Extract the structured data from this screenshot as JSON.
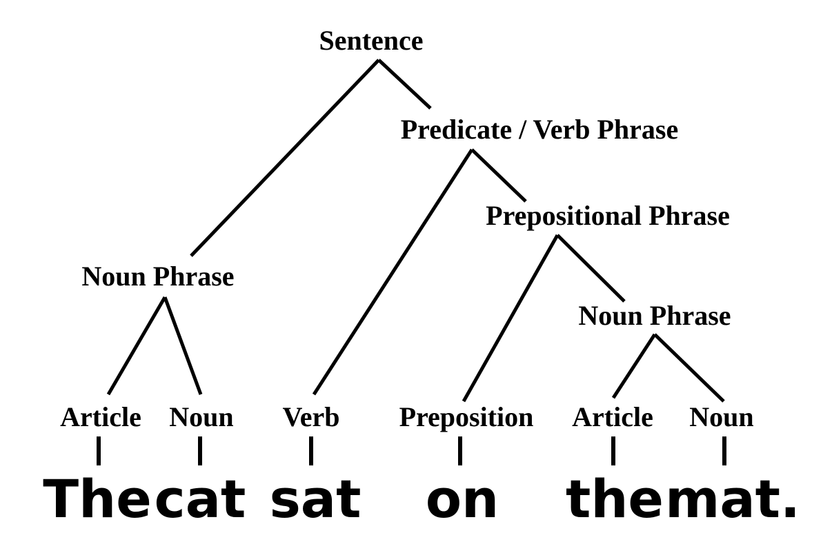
{
  "tree": {
    "root": "Sentence",
    "predicate": "Predicate / Verb Phrase",
    "prepositional_phrase": "Prepositional Phrase",
    "subject_noun_phrase": "Noun Phrase",
    "object_noun_phrase": "Noun Phrase"
  },
  "parts_of_speech": [
    "Article",
    "Noun",
    "Verb",
    "Preposition",
    "Article",
    "Noun"
  ],
  "words": [
    "The",
    "cat",
    "sat",
    "on",
    "the",
    "mat."
  ]
}
